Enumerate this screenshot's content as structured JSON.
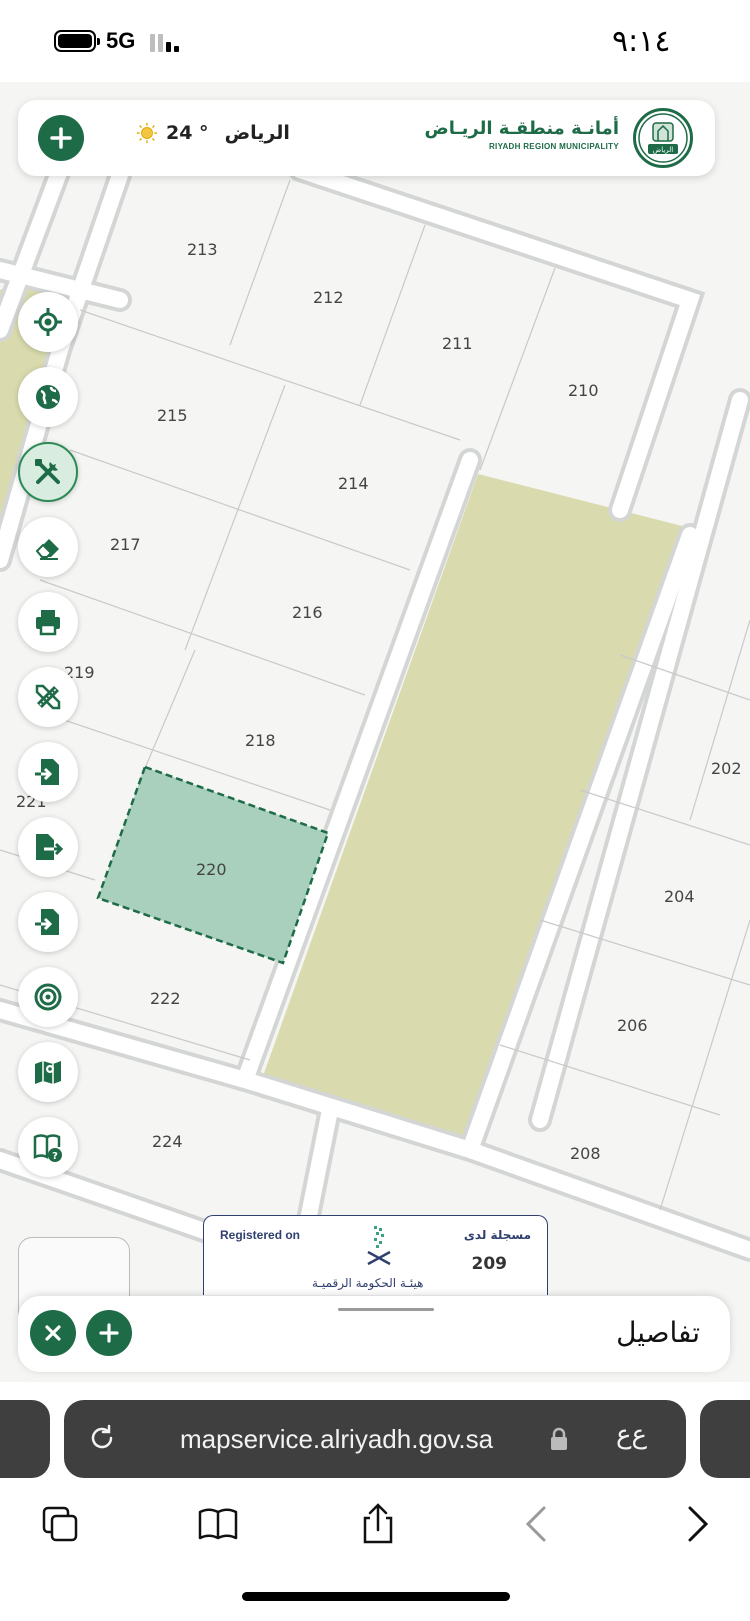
{
  "status_bar": {
    "network": "5G",
    "time": "٩:١٤"
  },
  "header": {
    "temperature": "24 °",
    "city": "الرياض",
    "brand_ar": "أمانـة منطقـة الريـاض",
    "brand_en": "RIYADH REGION MUNICIPALITY",
    "logo_text": "الرياض"
  },
  "toolbar": [
    {
      "name": "locate-button",
      "icon": "crosshair-icon"
    },
    {
      "name": "basemap-button",
      "icon": "globe-icon"
    },
    {
      "name": "tools-button",
      "icon": "tools-icon"
    },
    {
      "name": "eraser-button",
      "icon": "eraser-icon"
    },
    {
      "name": "print-button",
      "icon": "printer-icon"
    },
    {
      "name": "draw-button",
      "icon": "ruler-pencil-icon"
    },
    {
      "name": "import-button",
      "icon": "file-import-icon"
    },
    {
      "name": "export-button",
      "icon": "file-export-icon"
    },
    {
      "name": "import-file-button",
      "icon": "file-import-icon"
    },
    {
      "name": "target-button",
      "icon": "target-icon"
    },
    {
      "name": "map-layers-button",
      "icon": "map-icon"
    },
    {
      "name": "help-button",
      "icon": "book-help-icon"
    }
  ],
  "map": {
    "highlighted_parcel": "220",
    "parcels": [
      "213",
      "212",
      "211",
      "210",
      "215",
      "214",
      "217",
      "216",
      "219",
      "218",
      "221",
      "220",
      "222",
      "224",
      "202",
      "204",
      "206",
      "208"
    ]
  },
  "registration": {
    "label_en": "Registered on",
    "label_ar": "مسجلة لدى",
    "number": "209",
    "authority": "هيئـة الحكومة الرقميـة"
  },
  "details": {
    "title": "تفاصيل"
  },
  "browser": {
    "url": "mapservice.alriyadh.gov.sa",
    "text_size": "ﻉﻉ"
  },
  "colors": {
    "brand_green": "#1e6b47",
    "park": "#d9dbae",
    "selected_fill": "#a9cfbd"
  }
}
